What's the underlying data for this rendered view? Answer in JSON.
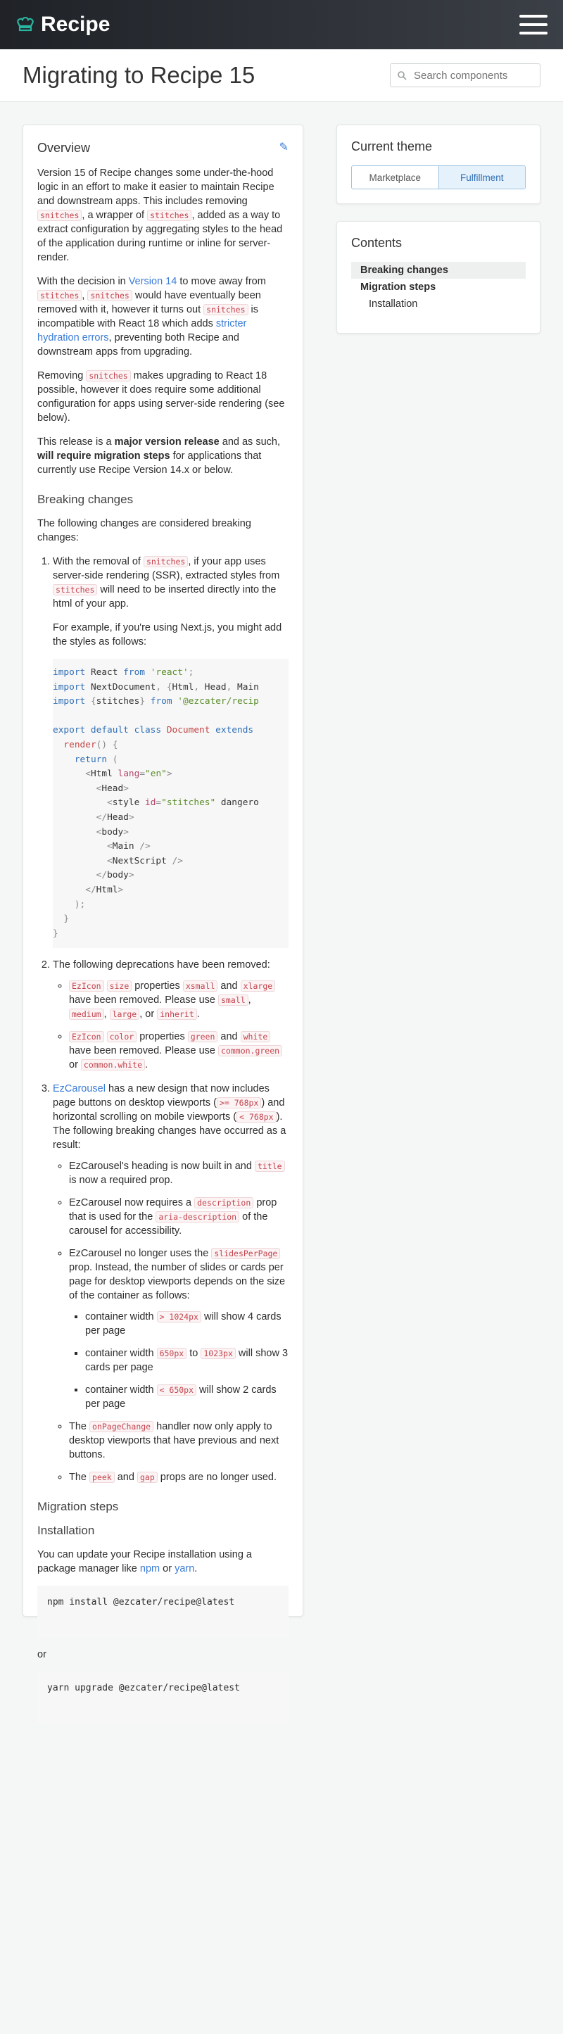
{
  "brand": {
    "name": "Recipe"
  },
  "page": {
    "title": "Migrating to Recipe 15"
  },
  "search": {
    "placeholder": "Search components"
  },
  "overview": {
    "heading": "Overview",
    "p1": [
      {
        "t": "Version 15 of Recipe changes some under-the-hood logic in an effort to make it easier to maintain Recipe and downstream apps. This includes removing "
      },
      {
        "c": "snitches"
      },
      {
        "t": ", a wrapper of "
      },
      {
        "c": "stitches"
      },
      {
        "t": ", added as a way to extract configuration by aggregating styles to the head of the application during runtime or inline for server-render."
      }
    ],
    "p2": [
      {
        "t": "With the decision in "
      },
      {
        "l": "Version 14"
      },
      {
        "t": " to move away from "
      },
      {
        "c": "stitches"
      },
      {
        "t": ", "
      },
      {
        "c": "snitches"
      },
      {
        "t": " would have eventually been removed with it, however it turns out "
      },
      {
        "c": "snitches"
      },
      {
        "t": " is incompatible with React 18 which adds "
      },
      {
        "l": "stricter hydration errors"
      },
      {
        "t": ", preventing both Recipe and downstream apps from upgrading."
      }
    ],
    "p3": [
      {
        "t": "Removing "
      },
      {
        "c": "snitches"
      },
      {
        "t": " makes upgrading to React 18 possible, however it does require some additional configuration for apps using server-side rendering (see below)."
      }
    ],
    "p4": [
      {
        "t": "This release is a "
      },
      {
        "b": "major version release"
      },
      {
        "t": " and as such, "
      },
      {
        "b": "will require migration steps"
      },
      {
        "t": " for applications that currently use Recipe Version 14.x or below."
      }
    ]
  },
  "breaking": {
    "heading": "Breaking changes",
    "intro": "The following changes are considered breaking changes:",
    "item1": [
      {
        "t": "With the removal of "
      },
      {
        "c": "snitches"
      },
      {
        "t": ", if your app uses server-side rendering (SSR), extracted styles from "
      },
      {
        "c": "stitches"
      },
      {
        "t": " will need to be inserted directly into the html of your app."
      }
    ],
    "item1b": "For example, if you're using Next.js, you might add the styles as follows:",
    "item2": "The following deprecations have been removed:",
    "item2a": [
      {
        "c": "EzIcon"
      },
      {
        "t": " "
      },
      {
        "c": "size"
      },
      {
        "t": " properties "
      },
      {
        "c": "xsmall"
      },
      {
        "t": " and "
      },
      {
        "c": "xlarge"
      },
      {
        "t": " have been removed. Please use "
      },
      {
        "c": "small"
      },
      {
        "t": ", "
      },
      {
        "c": "medium"
      },
      {
        "t": ", "
      },
      {
        "c": "large"
      },
      {
        "t": ", or "
      },
      {
        "c": "inherit"
      },
      {
        "t": "."
      }
    ],
    "item2b": [
      {
        "c": "EzIcon"
      },
      {
        "t": " "
      },
      {
        "c": "color"
      },
      {
        "t": " properties "
      },
      {
        "c": "green"
      },
      {
        "t": " and "
      },
      {
        "c": "white"
      },
      {
        "t": " have been removed. Please use "
      },
      {
        "c": "common.green"
      },
      {
        "t": " or "
      },
      {
        "c": "common.white"
      },
      {
        "t": "."
      }
    ],
    "item3": [
      {
        "l": "EzCarousel"
      },
      {
        "t": " has a new design that now includes page buttons on desktop viewports ("
      },
      {
        "c": ">= 768px"
      },
      {
        "t": ") and horizontal scrolling on mobile viewports ("
      },
      {
        "c": "< 768px"
      },
      {
        "t": "). The following breaking changes have occurred as a result:"
      }
    ],
    "item3a": [
      {
        "t": "EzCarousel's heading is now built in and "
      },
      {
        "c": "title"
      },
      {
        "t": " is now a required prop."
      }
    ],
    "item3b": [
      {
        "t": "EzCarousel now requires a "
      },
      {
        "c": "description"
      },
      {
        "t": " prop that is used for the "
      },
      {
        "c": "aria-description"
      },
      {
        "t": " of the carousel for accessibility."
      }
    ],
    "item3c": [
      {
        "t": "EzCarousel no longer uses the "
      },
      {
        "c": "slidesPerPage"
      },
      {
        "t": " prop. Instead, the number of slides or cards per page for desktop viewports depends on the size of the container as follows:"
      }
    ],
    "item3c1": [
      {
        "t": "container width "
      },
      {
        "c": "> 1024px"
      },
      {
        "t": " will show 4 cards per page"
      }
    ],
    "item3c2": [
      {
        "t": "container width "
      },
      {
        "c": "650px"
      },
      {
        "t": " to "
      },
      {
        "c": "1023px"
      },
      {
        "t": " will show 3 cards per page"
      }
    ],
    "item3c3": [
      {
        "t": "container width "
      },
      {
        "c": "< 650px"
      },
      {
        "t": " will show 2 cards per page"
      }
    ],
    "item3d": [
      {
        "t": "The "
      },
      {
        "c": "onPageChange"
      },
      {
        "t": " handler now only apply to desktop viewports that have previous and next buttons."
      }
    ],
    "item3e": [
      {
        "t": "The "
      },
      {
        "c": "peek"
      },
      {
        "t": " and "
      },
      {
        "c": "gap"
      },
      {
        "t": " props are no longer used."
      }
    ]
  },
  "code_lines": [
    [
      {
        "k": "kw",
        "v": "import"
      },
      {
        "v": " React "
      },
      {
        "k": "kw",
        "v": "from"
      },
      {
        "v": " "
      },
      {
        "k": "str",
        "v": "'react'"
      },
      {
        "k": "pun",
        "v": ";"
      }
    ],
    [
      {
        "k": "kw",
        "v": "import"
      },
      {
        "v": " NextDocument"
      },
      {
        "k": "pun",
        "v": ", {"
      },
      {
        "v": "Html"
      },
      {
        "k": "pun",
        "v": ", "
      },
      {
        "v": "Head"
      },
      {
        "k": "pun",
        "v": ", "
      },
      {
        "v": "Main"
      }
    ],
    [
      {
        "k": "kw",
        "v": "import"
      },
      {
        "v": " "
      },
      {
        "k": "pun",
        "v": "{"
      },
      {
        "v": "stitches"
      },
      {
        "k": "pun",
        "v": "}"
      },
      {
        "v": " "
      },
      {
        "k": "kw",
        "v": "from"
      },
      {
        "v": " "
      },
      {
        "k": "str",
        "v": "'@ezcater/recip"
      }
    ],
    [
      {
        "v": ""
      }
    ],
    [
      {
        "k": "kw",
        "v": "export default class"
      },
      {
        "v": " "
      },
      {
        "k": "cls",
        "v": "Document"
      },
      {
        "v": " "
      },
      {
        "k": "kw",
        "v": "extends"
      }
    ],
    [
      {
        "v": "  "
      },
      {
        "k": "cls",
        "v": "render"
      },
      {
        "k": "pun",
        "v": "() {"
      }
    ],
    [
      {
        "v": "    "
      },
      {
        "k": "kw",
        "v": "return"
      },
      {
        "v": " "
      },
      {
        "k": "pun",
        "v": "("
      }
    ],
    [
      {
        "v": "      "
      },
      {
        "k": "pun",
        "v": "<"
      },
      {
        "v": "Html "
      },
      {
        "k": "tag",
        "v": "lang"
      },
      {
        "k": "pun",
        "v": "="
      },
      {
        "k": "str",
        "v": "\"en\""
      },
      {
        "k": "pun",
        "v": ">"
      }
    ],
    [
      {
        "v": "        "
      },
      {
        "k": "pun",
        "v": "<"
      },
      {
        "v": "Head"
      },
      {
        "k": "pun",
        "v": ">"
      }
    ],
    [
      {
        "v": "          "
      },
      {
        "k": "pun",
        "v": "<"
      },
      {
        "v": "style "
      },
      {
        "k": "tag",
        "v": "id"
      },
      {
        "k": "pun",
        "v": "="
      },
      {
        "k": "str",
        "v": "\"stitches\""
      },
      {
        "v": " dangero"
      }
    ],
    [
      {
        "v": "        "
      },
      {
        "k": "pun",
        "v": "</"
      },
      {
        "v": "Head"
      },
      {
        "k": "pun",
        "v": ">"
      }
    ],
    [
      {
        "v": "        "
      },
      {
        "k": "pun",
        "v": "<"
      },
      {
        "v": "body"
      },
      {
        "k": "pun",
        "v": ">"
      }
    ],
    [
      {
        "v": "          "
      },
      {
        "k": "pun",
        "v": "<"
      },
      {
        "v": "Main "
      },
      {
        "k": "pun",
        "v": "/>"
      }
    ],
    [
      {
        "v": "          "
      },
      {
        "k": "pun",
        "v": "<"
      },
      {
        "v": "NextScript "
      },
      {
        "k": "pun",
        "v": "/>"
      }
    ],
    [
      {
        "v": "        "
      },
      {
        "k": "pun",
        "v": "</"
      },
      {
        "v": "body"
      },
      {
        "k": "pun",
        "v": ">"
      }
    ],
    [
      {
        "v": "      "
      },
      {
        "k": "pun",
        "v": "</"
      },
      {
        "v": "Html"
      },
      {
        "k": "pun",
        "v": ">"
      }
    ],
    [
      {
        "v": "    "
      },
      {
        "k": "pun",
        "v": ");"
      }
    ],
    [
      {
        "v": "  "
      },
      {
        "k": "pun",
        "v": "}"
      }
    ],
    [
      {
        "k": "pun",
        "v": "}"
      }
    ]
  ],
  "migration": {
    "heading": "Migration steps",
    "install_heading": "Installation",
    "install_text": [
      {
        "t": "You can update your Recipe installation using a package manager like "
      },
      {
        "l": "npm"
      },
      {
        "t": " or "
      },
      {
        "l": "yarn"
      },
      {
        "t": "."
      }
    ],
    "npm_cmd": "npm install @ezcater/recipe@latest",
    "or": "or",
    "yarn_cmd": "yarn upgrade @ezcater/recipe@latest"
  },
  "theme": {
    "heading": "Current theme",
    "options": [
      "Marketplace",
      "Fulfillment"
    ],
    "selected": "Fulfillment"
  },
  "contents": {
    "heading": "Contents",
    "items": [
      {
        "label": "Breaking changes",
        "style": "sel"
      },
      {
        "label": "Migration steps",
        "style": "b"
      },
      {
        "label": "Installation",
        "style": "sub"
      }
    ]
  },
  "colors": {
    "accent": "#3a7bd5",
    "code": "#c3444d",
    "logo_green": "#2bb5a0"
  }
}
